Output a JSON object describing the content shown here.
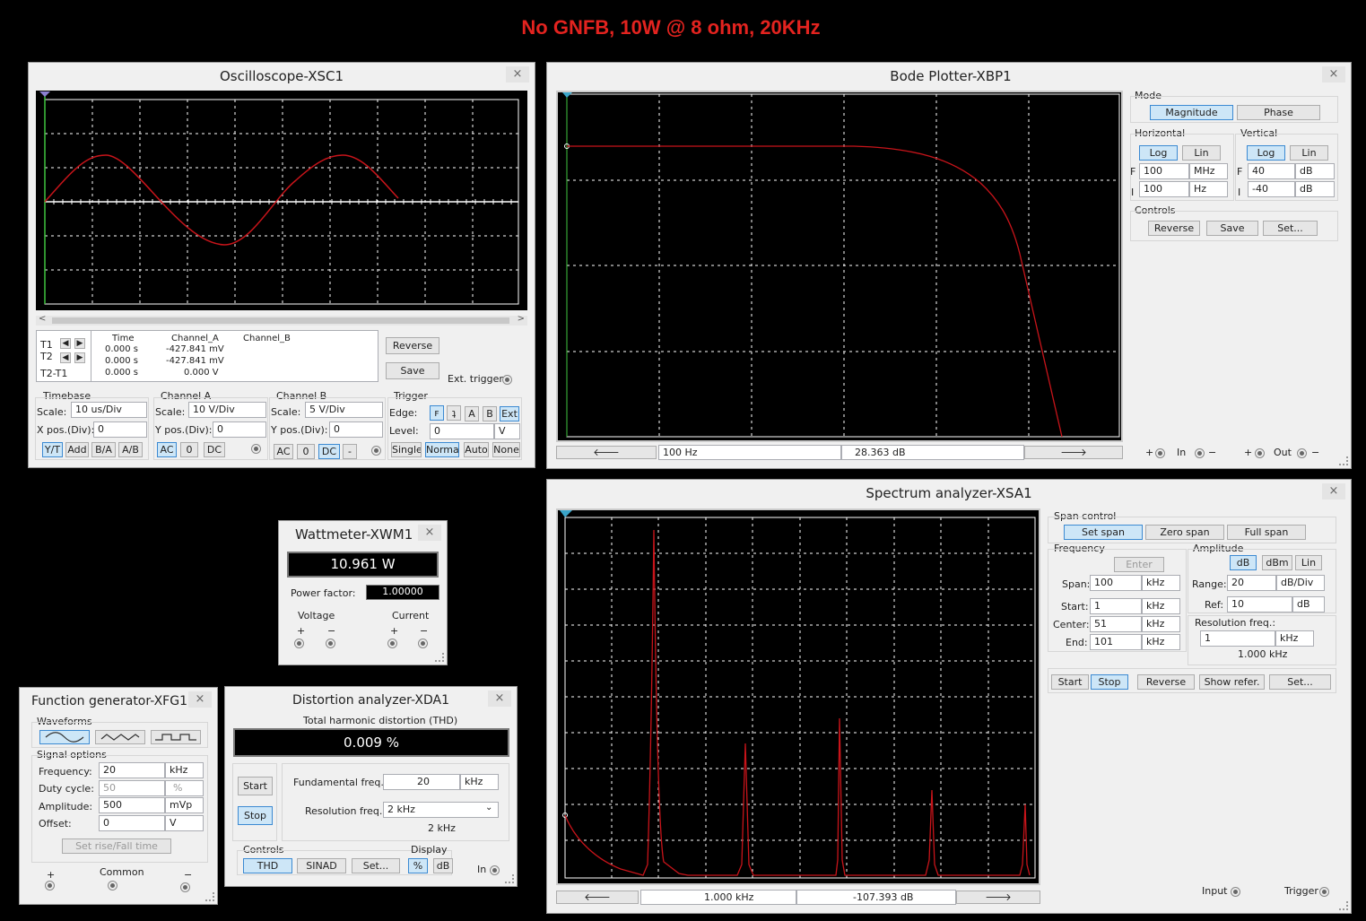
{
  "page_title": "No GNFB, 10W @ 8 ohm, 20KHz",
  "oscilloscope": {
    "title": "Oscilloscope-XSC1",
    "close": "×",
    "cursor_table": {
      "headers": [
        "Time",
        "Channel_A",
        "Channel_B"
      ],
      "rows": [
        {
          "label": "T1",
          "time": "0.000 s",
          "cha": "-427.841 mV",
          "chb": ""
        },
        {
          "label": "T2",
          "time": "0.000 s",
          "cha": "-427.841 mV",
          "chb": ""
        },
        {
          "label": "T2-T1",
          "time": "0.000 s",
          "cha": "0.000 V",
          "chb": ""
        }
      ]
    },
    "reverse_label": "Reverse",
    "save_label": "Save",
    "ext_trigger_label": "Ext. trigger",
    "timebase": {
      "label": "Timebase",
      "scale_label": "Scale:",
      "scale": "10 us/Div",
      "xpos_label": "X pos.(Div):",
      "xpos": "0",
      "buttons": [
        "Y/T",
        "Add",
        "B/A",
        "A/B"
      ]
    },
    "channel_a": {
      "label": "Channel A",
      "scale_label": "Scale:",
      "scale": "10  V/Div",
      "ypos_label": "Y pos.(Div):",
      "ypos": "0",
      "buttons": [
        "AC",
        "0",
        "DC"
      ]
    },
    "channel_b": {
      "label": "Channel B",
      "scale_label": "Scale:",
      "scale": "5  V/Div",
      "ypos_label": "Y pos.(Div):",
      "ypos": "0",
      "buttons": [
        "AC",
        "0",
        "DC",
        "-"
      ]
    },
    "trigger": {
      "label": "Trigger",
      "edge_label": "Edge:",
      "level_label": "Level:",
      "level": "0",
      "level_unit": "V",
      "edge_buttons": [
        "A",
        "B",
        "Ext"
      ],
      "mode_buttons": [
        "Single",
        "Normal",
        "Auto",
        "None"
      ]
    }
  },
  "bode": {
    "title": "Bode Plotter-XBP1",
    "close": "×",
    "mode_label": "Mode",
    "magnitude_label": "Magnitude",
    "phase_label": "Phase",
    "horizontal": {
      "label": "Horizontal",
      "log": "Log",
      "lin": "Lin",
      "f_label": "F",
      "f_value": "100",
      "f_unit": "MHz",
      "i_label": "I",
      "i_value": "100",
      "i_unit": "Hz"
    },
    "vertical": {
      "label": "Vertical",
      "log": "Log",
      "lin": "Lin",
      "f_label": "F",
      "f_value": "40",
      "f_unit": "dB",
      "i_label": "I",
      "i_value": "-40",
      "i_unit": "dB"
    },
    "controls_label": "Controls",
    "reverse_label": "Reverse",
    "save_label": "Save",
    "set_label": "Set...",
    "readout_freq": "100  Hz",
    "readout_db": "28.363 dB",
    "in_label": "In",
    "out_label": "Out",
    "plus": "+",
    "minus": "−"
  },
  "spectrum": {
    "title": "Spectrum analyzer-XSA1",
    "close": "×",
    "span_control_label": "Span control",
    "set_span": "Set span",
    "zero_span": "Zero span",
    "full_span": "Full span",
    "frequency_label": "Frequency",
    "enter_label": "Enter",
    "span_label": "Span:",
    "span_value": "100",
    "span_unit": "kHz",
    "start_label": "Start:",
    "start_value": "1",
    "start_unit": "kHz",
    "center_label": "Center:",
    "center_value": "51",
    "center_unit": "kHz",
    "end_label": "End:",
    "end_value": "101",
    "end_unit": "kHz",
    "amplitude_label": "Amplitude",
    "amp_db": "dB",
    "amp_dbm": "dBm",
    "amp_lin": "Lin",
    "range_label": "Range:",
    "range_value": "20",
    "range_unit": "dB/Div",
    "ref_label": "Ref:",
    "ref_value": "10",
    "ref_unit": "dB",
    "res_label": "Resolution freq.:",
    "res_value": "1",
    "res_unit": "kHz",
    "res_readout": "1.000 kHz",
    "start_btn": "Start",
    "stop_btn": "Stop",
    "reverse_btn": "Reverse",
    "show_refer_btn": "Show refer.",
    "set_btn": "Set...",
    "readout_freq": "1.000 kHz",
    "readout_db": "-107.393  dB",
    "input_label": "Input",
    "trigger_label": "Trigger"
  },
  "wattmeter": {
    "title": "Wattmeter-XWM1",
    "close": "×",
    "reading": "10.961 W",
    "pf_label": "Power factor:",
    "pf_value": "1.00000",
    "voltage_label": "Voltage",
    "current_label": "Current",
    "plus": "+",
    "minus": "−"
  },
  "function_generator": {
    "title": "Function generator-XFG1",
    "close": "×",
    "waveforms_label": "Waveforms",
    "signal_options_label": "Signal options",
    "frequency_label": "Frequency:",
    "frequency_value": "20",
    "frequency_unit": "kHz",
    "duty_label": "Duty cycle:",
    "duty_value": "50",
    "duty_unit": "%",
    "amplitude_label": "Amplitude:",
    "amplitude_value": "500",
    "amplitude_unit": "mVp",
    "offset_label": "Offset:",
    "offset_value": "0",
    "offset_unit": "V",
    "rise_fall_label": "Set rise/Fall time",
    "plus": "+",
    "common": "Common",
    "minus": "−"
  },
  "distortion": {
    "title": "Distortion analyzer-XDA1",
    "close": "×",
    "thd_label": "Total harmonic distortion (THD)",
    "thd_value": "0.009 %",
    "start_btn": "Start",
    "stop_btn": "Stop",
    "fund_label": "Fundamental freq.:",
    "fund_value": "20",
    "fund_unit": "kHz",
    "res_label": "Resolution freq.:",
    "res_value": "2 kHz",
    "res_readout": "2 kHz",
    "controls_label": "Controls",
    "thd_btn": "THD",
    "sinad_btn": "SINAD",
    "set_btn": "Set...",
    "display_label": "Display",
    "pct_btn": "%",
    "db_btn": "dB",
    "in_label": "In"
  },
  "colors": {
    "trace": "#c8141a",
    "grid": "#ffffff",
    "accent_blue": "#3c8ad2",
    "title_red": "#e3231f"
  }
}
